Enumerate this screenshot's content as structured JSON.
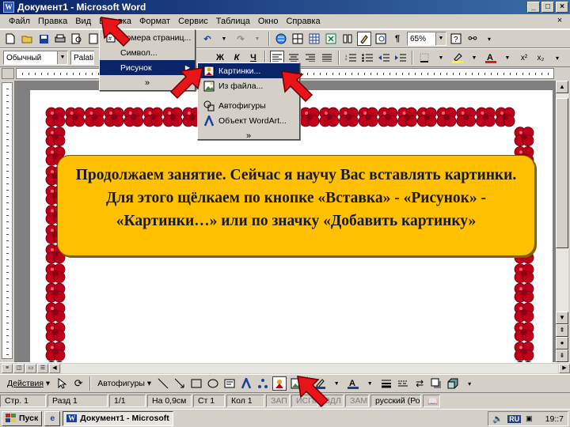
{
  "window": {
    "title": "Документ1 - Microsoft Word",
    "app_icon": "W"
  },
  "menubar": {
    "items": [
      "Файл",
      "Правка",
      "Вид",
      "Вставка",
      "Формат",
      "Сервис",
      "Таблица",
      "Окно",
      "Справка"
    ]
  },
  "toolbar_std": {
    "zoom": "65%"
  },
  "toolbar_fmt": {
    "style": "Обычный",
    "font": "Palati"
  },
  "insert_menu": {
    "items": [
      {
        "label": "Номера страниц...",
        "icon": "page-numbers-icon"
      },
      {
        "label": "Символ...",
        "icon": ""
      },
      {
        "label": "Рисунок",
        "icon": ""
      }
    ]
  },
  "picture_submenu": {
    "items": [
      {
        "label": "Картинки...",
        "icon": "clipart-icon"
      },
      {
        "label": "Из файла...",
        "icon": "picture-file-icon"
      },
      {
        "label": "Автофигуры",
        "icon": "autoshapes-icon"
      },
      {
        "label": "Объект WordArt...",
        "icon": "wordart-icon"
      }
    ]
  },
  "callout": {
    "text": "Продолжаем занятие. Сейчас я научу Вас вставлять картинки. Для этого щёлкаем по кнопке «Вставка» - «Рисунок» - «Картинки…» или по значку «Добавить картинку»"
  },
  "drawbar": {
    "actions_label": "Действия",
    "autoshapes_label": "Автофигуры"
  },
  "statusbar": {
    "page": "Стр. 1",
    "section": "Разд 1",
    "pages": "1/1",
    "at": "На 0,9см",
    "line": "Ст 1",
    "col": "Кол 1",
    "rec": "ЗАП",
    "trk": "ИСПР",
    "ext": "ВДЛ",
    "ovr": "ЗАМ",
    "language": "русский (Ро"
  },
  "taskbar": {
    "start": "Пуск",
    "task": "Документ1 - Microsoft",
    "lang": "RU",
    "clock": "19::7"
  },
  "colors": {
    "title_blue": "#0a246a",
    "callout_fill": "#ffc000",
    "flower_red": "#c0001a",
    "arrow_red": "#e8141a"
  }
}
